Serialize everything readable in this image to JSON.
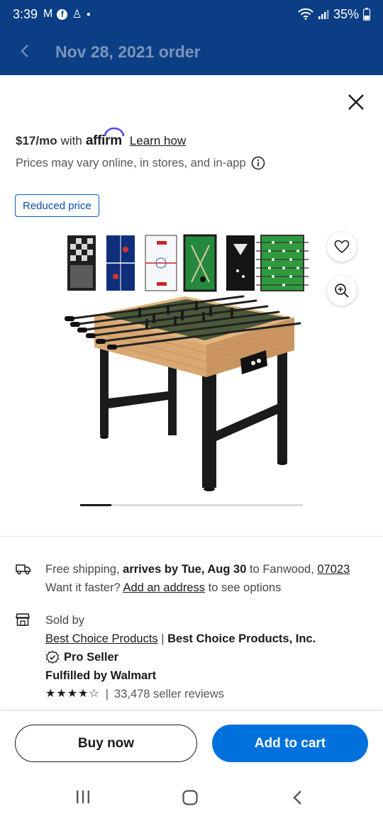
{
  "status": {
    "time": "3:39",
    "battery": "35%"
  },
  "header": {
    "title": "Nov 28, 2021 order"
  },
  "affirm": {
    "price": "$17/mo",
    "with": "with",
    "brand": "affirm",
    "learn": "Learn how"
  },
  "notice": {
    "text": "Prices may vary online, in stores, and in-app"
  },
  "badge": {
    "label": "Reduced price"
  },
  "shipping": {
    "prefix": "Free shipping, ",
    "arrives": "arrives by Tue, Aug 30",
    "to": " to Fanwood, ",
    "zip": "07023",
    "faster": "Want it faster? ",
    "add_address": "Add an address",
    "suffix": " to see options"
  },
  "seller": {
    "sold_by": "Sold by",
    "name_link": "Best Choice Products",
    "separator": " | ",
    "company": "Best Choice Products, Inc.",
    "pro": "Pro Seller",
    "fulfilled": "Fulfilled by Walmart",
    "stars": "★★★★☆",
    "reviews": "33,478 seller reviews"
  },
  "actions": {
    "buy_now": "Buy now",
    "add_to_cart": "Add to cart"
  },
  "colors": {
    "header_bg": "#0b3e84",
    "accent": "#0071dc",
    "badge": "#0a5bc4"
  }
}
